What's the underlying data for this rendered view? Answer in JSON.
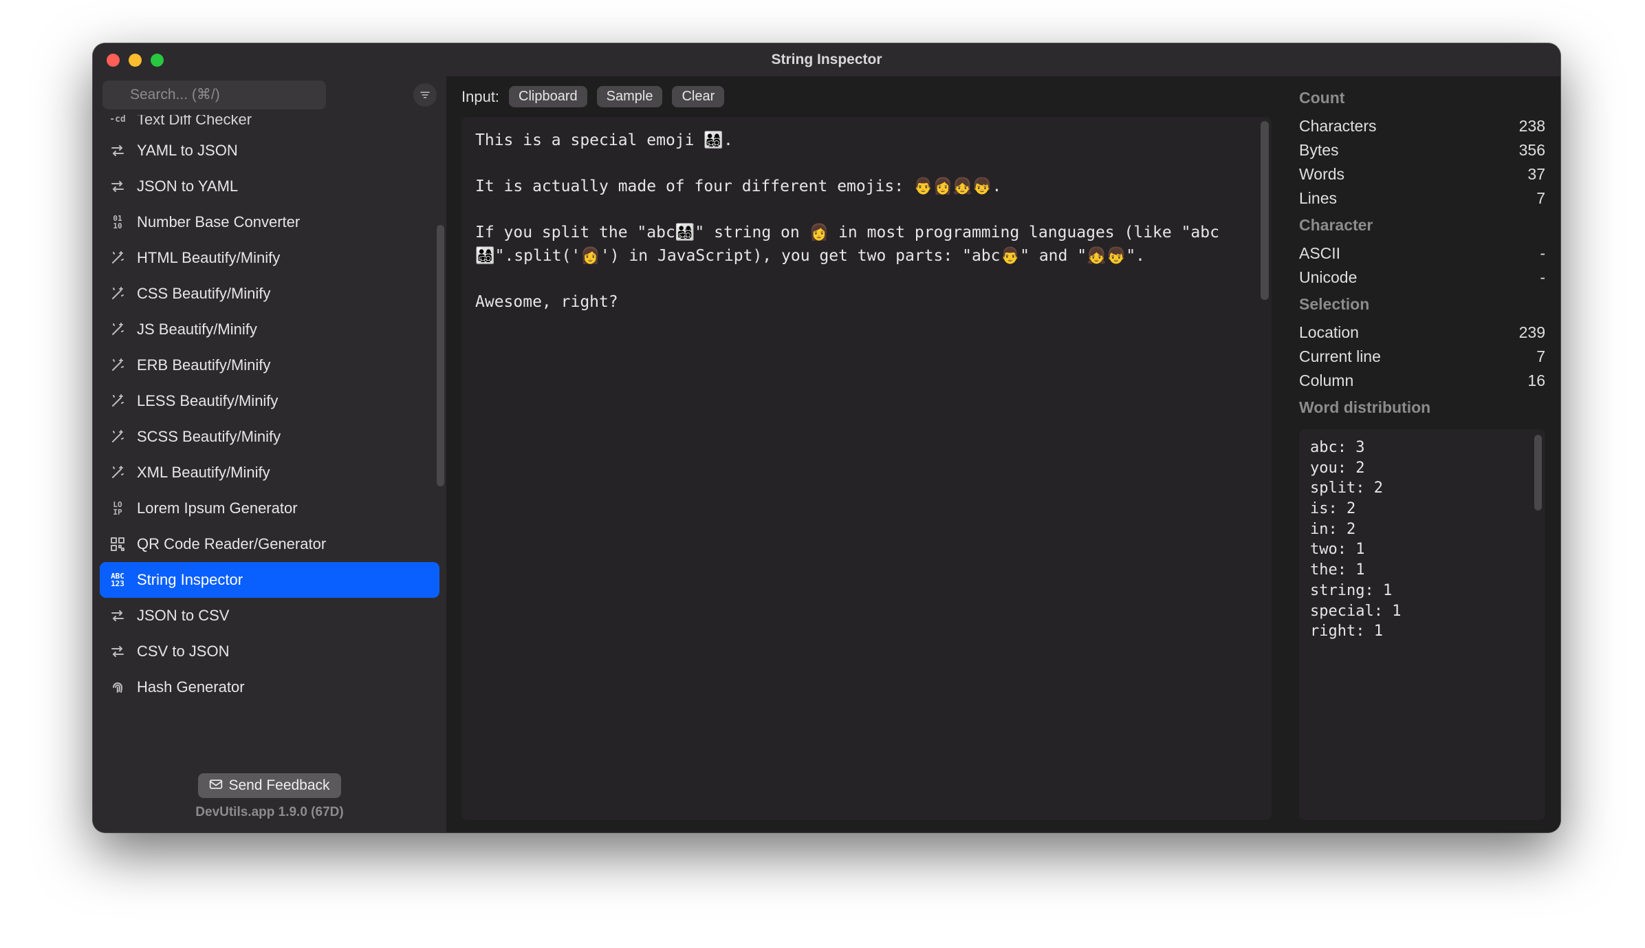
{
  "window": {
    "title": "String Inspector"
  },
  "search": {
    "placeholder": "Search... (⌘/)"
  },
  "sidebar": {
    "cutoff_top": "Text Diff Checker",
    "items": [
      {
        "label": "YAML to JSON",
        "icon": "swap"
      },
      {
        "label": "JSON to YAML",
        "icon": "swap"
      },
      {
        "label": "Number Base Converter",
        "icon": "binary"
      },
      {
        "label": "HTML Beautify/Minify",
        "icon": "wand"
      },
      {
        "label": "CSS Beautify/Minify",
        "icon": "wand"
      },
      {
        "label": "JS Beautify/Minify",
        "icon": "wand"
      },
      {
        "label": "ERB Beautify/Minify",
        "icon": "wand"
      },
      {
        "label": "LESS Beautify/Minify",
        "icon": "wand"
      },
      {
        "label": "SCSS Beautify/Minify",
        "icon": "wand"
      },
      {
        "label": "XML Beautify/Minify",
        "icon": "wand"
      },
      {
        "label": "Lorem Ipsum Generator",
        "icon": "lorem"
      },
      {
        "label": "QR Code Reader/Generator",
        "icon": "qr"
      },
      {
        "label": "String Inspector",
        "icon": "abc123"
      },
      {
        "label": "JSON to CSV",
        "icon": "swap"
      },
      {
        "label": "CSV to JSON",
        "icon": "swap"
      },
      {
        "label": "Hash Generator",
        "icon": "fingerprint"
      }
    ],
    "active_index": 12,
    "feedback_label": "Send Feedback",
    "version": "DevUtils.app 1.9.0 (67D)"
  },
  "main": {
    "input_label": "Input:",
    "buttons": {
      "clipboard": "Clipboard",
      "sample": "Sample",
      "clear": "Clear"
    },
    "content": "This is a special emoji 👨‍👩‍👧‍👦.\n\nIt is actually made of four different emojis: 👨👩👧👦.\n\nIf you split the \"abc👨‍👩‍👧‍👦\" string on 👩 in most programming languages (like \"abc👨‍👩‍👧‍👦\".split('👩') in JavaScript), you get two parts: \"abc👨‍\" and \"‍👧‍👦\".\n\nAwesome, right?"
  },
  "panel": {
    "count": {
      "heading": "Count",
      "characters": {
        "label": "Characters",
        "value": "238"
      },
      "bytes": {
        "label": "Bytes",
        "value": "356"
      },
      "words": {
        "label": "Words",
        "value": "37"
      },
      "lines": {
        "label": "Lines",
        "value": "7"
      }
    },
    "character": {
      "heading": "Character",
      "ascii": {
        "label": "ASCII",
        "value": "-"
      },
      "unicode": {
        "label": "Unicode",
        "value": "-"
      }
    },
    "selection": {
      "heading": "Selection",
      "location": {
        "label": "Location",
        "value": "239"
      },
      "current_line": {
        "label": "Current line",
        "value": "7"
      },
      "column": {
        "label": "Column",
        "value": "16"
      }
    },
    "distribution": {
      "heading": "Word distribution",
      "text": "abc: 3\nyou: 2\nsplit: 2\nis: 2\nin: 2\ntwo: 1\nthe: 1\nstring: 1\nspecial: 1\nright: 1"
    }
  }
}
